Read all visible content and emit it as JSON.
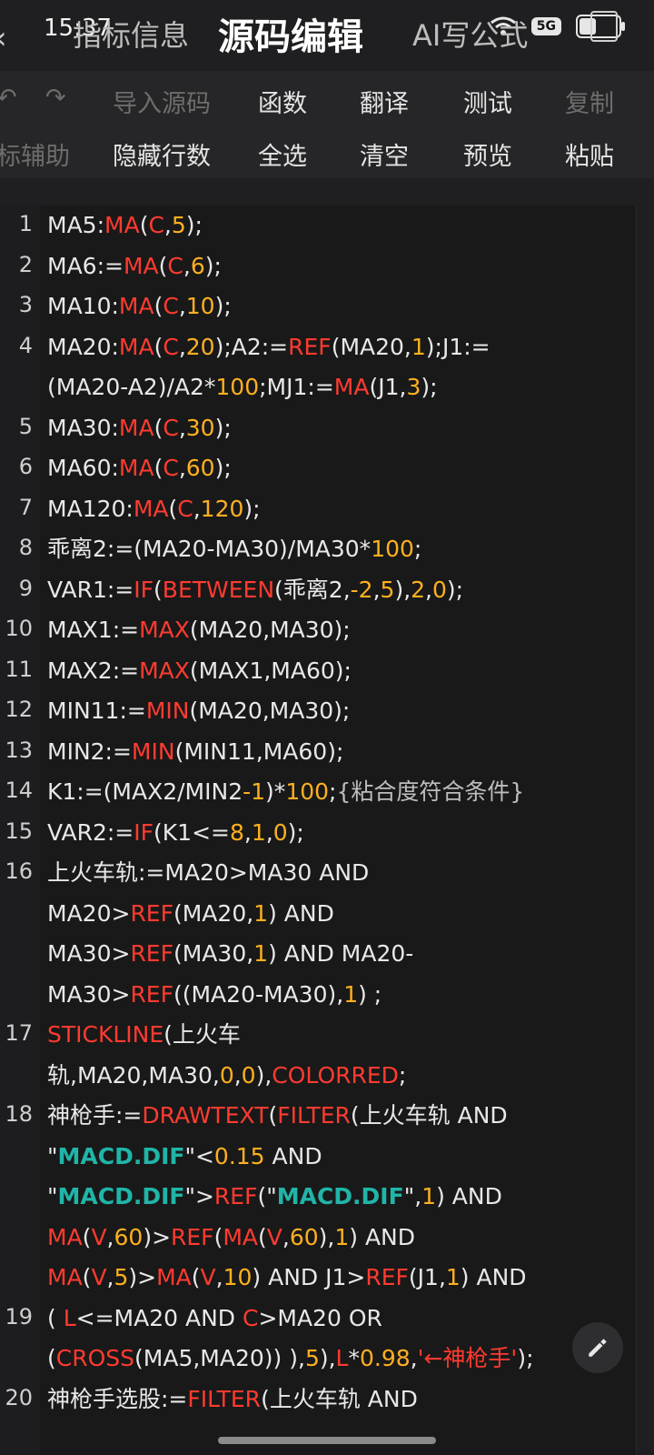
{
  "status": {
    "time": "15:37",
    "badge": "5G"
  },
  "tabs": {
    "t1": "指标信息",
    "t2": "源码编辑",
    "t3": "AI写公式"
  },
  "toolbar1": {
    "t1": "导入源码",
    "t2": "函数",
    "t3": "翻译",
    "t4": "测试",
    "t5": "复制"
  },
  "toolbar2": {
    "t1": "标辅助",
    "t2": "隐藏行数",
    "t3": "全选",
    "t4": "清空",
    "t5": "预览",
    "t6": "粘贴"
  },
  "code": {
    "n1": "1",
    "n2": "2",
    "n3": "3",
    "n4": "4",
    "n5": "5",
    "n6": "6",
    "n7": "7",
    "n8": "8",
    "n9": "9",
    "n10": "10",
    "n11": "11",
    "n12": "12",
    "n13": "13",
    "n14": "14",
    "n15": "15",
    "n16": "16",
    "n17": "17",
    "n18": "18",
    "n19": "19",
    "n20": "20",
    "ma": "MA",
    "ref": "REF",
    "if": "IF",
    "between": "BETWEEN",
    "max": "MAX",
    "min": "MIN",
    "stickline": "STICKLINE",
    "colorred": "COLORRED",
    "drawtext": "DRAWTEXT",
    "filter": "FILTER",
    "cross": "CROSS",
    "c": "C",
    "v": "V",
    "l": "L",
    "macd": "MACD.DIF",
    "comment": "{粘合度符合条件}",
    "shen": "'←神枪手'"
  }
}
